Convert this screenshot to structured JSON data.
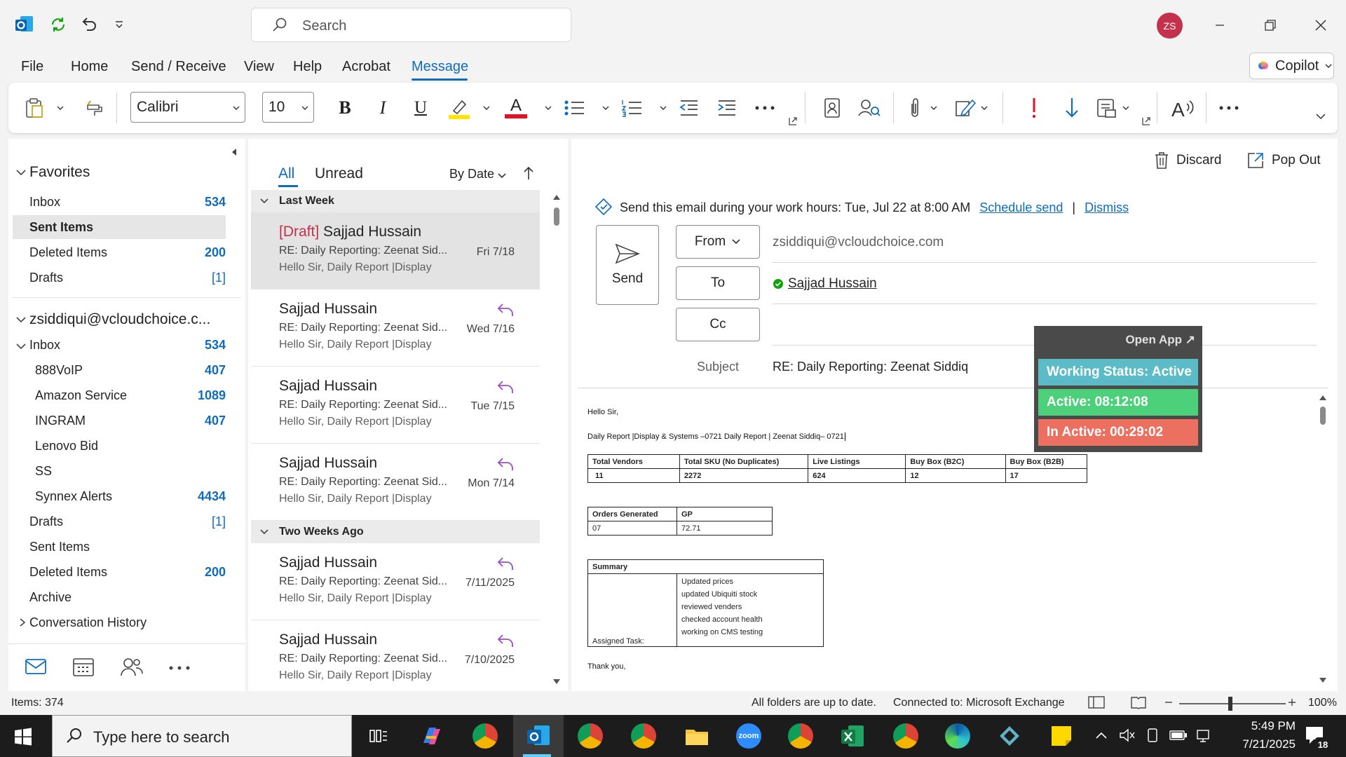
{
  "titlebar": {
    "search_placeholder": "Search",
    "avatar_initials": "ZS"
  },
  "menu": {
    "tabs": [
      "File",
      "Home",
      "Send / Receive",
      "View",
      "Help",
      "Acrobat",
      "Message"
    ],
    "active": "Message",
    "copilot_label": "Copilot"
  },
  "ribbon": {
    "font_name": "Calibri",
    "font_size": "10",
    "bold": "B",
    "italic": "I",
    "underline": "U",
    "font_color": "A"
  },
  "nav": {
    "favorites_label": "Favorites",
    "favorites": [
      {
        "label": "Inbox",
        "count": "534"
      },
      {
        "label": "Sent Items",
        "count": ""
      },
      {
        "label": "Deleted Items",
        "count": "200"
      },
      {
        "label": "Drafts",
        "count": "[1]"
      }
    ],
    "account_label": "zsiddiqui@vcloudchoice.c...",
    "inbox_label": "Inbox",
    "inbox_count": "534",
    "inbox_children": [
      {
        "label": "888VoIP",
        "count": "407"
      },
      {
        "label": "Amazon Service",
        "count": "1089"
      },
      {
        "label": "INGRAM",
        "count": "407"
      },
      {
        "label": "Lenovo Bid",
        "count": ""
      },
      {
        "label": "SS",
        "count": ""
      },
      {
        "label": "Synnex Alerts",
        "count": "4434"
      }
    ],
    "folders": [
      {
        "label": "Drafts",
        "count": "[1]"
      },
      {
        "label": "Sent Items",
        "count": ""
      },
      {
        "label": "Deleted Items",
        "count": "200"
      },
      {
        "label": "Archive",
        "count": ""
      },
      {
        "label": "Conversation History",
        "count": ""
      }
    ]
  },
  "maillist": {
    "tab_all": "All",
    "tab_unread": "Unread",
    "sort_label": "By Date",
    "groups": [
      "Last Week",
      "Two Weeks Ago"
    ],
    "items": [
      {
        "draft": "[Draft]",
        "sender": "Sajjad Hussain",
        "subject": "RE: Daily Reporting: Zeenat Sid...",
        "preview": "Hello Sir,  Daily Report |Display",
        "date": "Fri 7/18"
      },
      {
        "draft": "",
        "sender": "Sajjad Hussain",
        "subject": "RE: Daily Reporting: Zeenat Sid...",
        "preview": "Hello Sir,  Daily Report |Display",
        "date": "Wed 7/16"
      },
      {
        "draft": "",
        "sender": "Sajjad Hussain",
        "subject": "RE: Daily Reporting: Zeenat Sid...",
        "preview": "Hello Sir,  Daily Report |Display",
        "date": "Tue 7/15"
      },
      {
        "draft": "",
        "sender": "Sajjad Hussain",
        "subject": "RE: Daily Reporting: Zeenat Sid...",
        "preview": "Hello Sir,  Daily Report |Display",
        "date": "Mon 7/14"
      },
      {
        "draft": "",
        "sender": "Sajjad Hussain",
        "subject": "RE: Daily Reporting: Zeenat Sid...",
        "preview": "Hello Sir,  Daily Report |Display",
        "date": "7/11/2025"
      },
      {
        "draft": "",
        "sender": "Sajjad Hussain",
        "subject": "RE: Daily Reporting: Zeenat Sid...",
        "preview": "Hello Sir,  Daily Report |Display",
        "date": "7/10/2025"
      }
    ]
  },
  "compose": {
    "discard_label": "Discard",
    "popout_label": "Pop Out",
    "send_hint": "Send this email during your work hours: Tue, Jul 22 at 8:00 AM",
    "schedule_send": "Schedule send",
    "separator": "|",
    "dismiss": "Dismiss",
    "send_label": "Send",
    "from_label": "From",
    "from_value": "zsiddiqui@vcloudchoice.com",
    "to_label": "To",
    "to_value": "Sajjad Hussain",
    "cc_label": "Cc",
    "subject_label": "Subject",
    "subject_value": "RE: Daily Reporting: Zeenat Siddiq",
    "body": {
      "greeting": "Hello Sir,",
      "line1": "Daily Report |Display & Systems –0721 Daily Report | Zeenat Siddiq– 0721",
      "table1_headers": [
        "Total Vendors",
        "Total SKU (No Duplicates)",
        "Live Listings",
        "Buy Box (B2C)",
        "Buy Box (B2B)"
      ],
      "table1_values": [
        "11",
        "2272",
        "624",
        "12",
        "17"
      ],
      "table2_headers": [
        "Orders Generated",
        "GP"
      ],
      "table2_values": [
        "07",
        "72.71"
      ],
      "summary_label": "Summary",
      "assigned_label": "Assigned Task:",
      "tasks": [
        "Updated prices",
        "updated Ubiquiti stock",
        "reviewed venders",
        "checked account health",
        "working on CMS testing"
      ],
      "closing": "Thank you,"
    }
  },
  "widget": {
    "open_app": "Open App ↗",
    "status": "Working Status: Active",
    "active": "Active: 08:12:08",
    "inactive": "In Active: 00:29:02"
  },
  "statusbar": {
    "items": "Items: 374",
    "sync": "All folders are up to date.",
    "connection": "Connected to: Microsoft Exchange",
    "zoom": "100%"
  },
  "taskbar": {
    "search_placeholder": "Type here to search",
    "time": "5:49 PM",
    "date": "7/21/2025",
    "notifications": "18"
  }
}
